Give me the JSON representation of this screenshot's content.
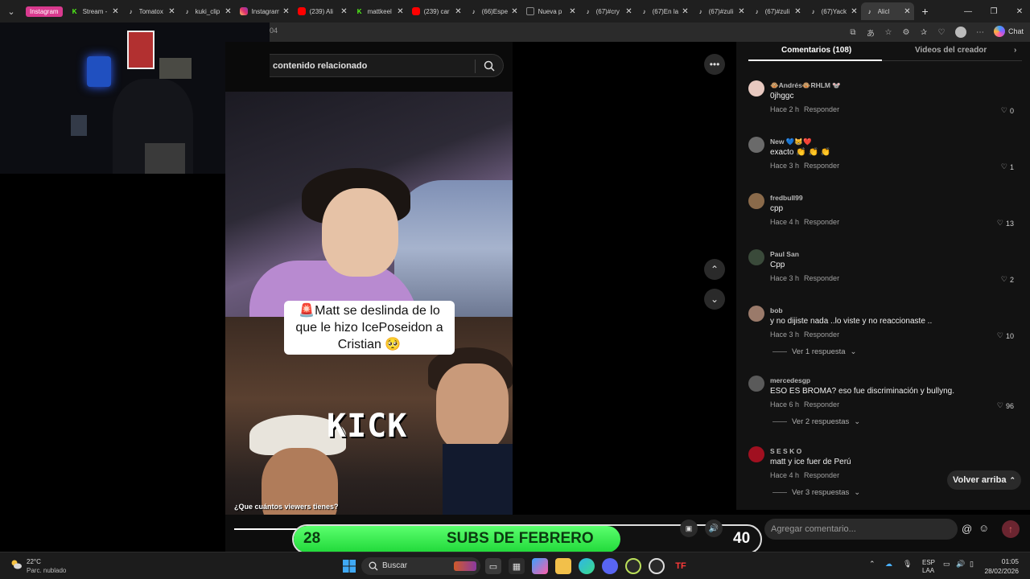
{
  "browser": {
    "tab_group_label": "Instagram",
    "tabs": [
      {
        "title": "Stream -",
        "icon": "kick-icon",
        "color": "#53fc18"
      },
      {
        "title": "Tomatox",
        "icon": "tiktok-icon",
        "color": "#ffffff"
      },
      {
        "title": "kuki_clip",
        "icon": "tiktok-icon",
        "color": "#ffffff"
      },
      {
        "title": "Instagram",
        "icon": "instagram-icon",
        "color": "#e1306c"
      },
      {
        "title": "(239) Ali",
        "icon": "youtube-icon",
        "color": "#ff0000"
      },
      {
        "title": "mattkeel",
        "icon": "kick-icon",
        "color": "#53fc18"
      },
      {
        "title": "(239) car",
        "icon": "youtube-icon",
        "color": "#ff0000"
      },
      {
        "title": "(66)Espe",
        "icon": "tiktok-icon",
        "color": "#ffffff"
      },
      {
        "title": "Nueva p",
        "icon": "newtab-icon",
        "color": "#888888"
      },
      {
        "title": "(67)#cry",
        "icon": "tiktok-icon",
        "color": "#ffffff"
      },
      {
        "title": "(67)En la",
        "icon": "tiktok-icon",
        "color": "#ffffff"
      },
      {
        "title": "(67)#zuli",
        "icon": "tiktok-icon",
        "color": "#ffffff"
      },
      {
        "title": "(67)#zuli",
        "icon": "tiktok-icon",
        "color": "#ffffff"
      },
      {
        "title": "(67)Yack",
        "icon": "tiktok-icon",
        "color": "#ffffff"
      },
      {
        "title": "Alicl",
        "icon": "tiktok-icon",
        "color": "#ffffff",
        "active": true
      }
    ],
    "url_fragment": "04",
    "chat_label": "Chat"
  },
  "video": {
    "search_text": "contenido relacionado",
    "caption_line1": "🚨Matt se deslinda de lo",
    "caption_line2": "que le hizo IcePoseidon a",
    "caption_line3": "Cristian 🥺",
    "logo_text": "KICK",
    "subtitle": "¿Que cuántos viewers tienes?"
  },
  "comments_panel": {
    "tab_comments": "Comentarios (108)",
    "tab_creator": "Videos del creador",
    "items": [
      {
        "user": "🐵Andrés🐵RHLM 🐭",
        "text": "0jhggc",
        "time": "Hace 2 h",
        "reply": "Responder",
        "likes": "0",
        "avatar_color": "#e8c9c0"
      },
      {
        "user": "New 💙😸❤️",
        "text": "exacto 👏 👏 👏",
        "time": "Hace 3 h",
        "reply": "Responder",
        "likes": "1",
        "avatar_color": "#6a6a6a"
      },
      {
        "user": "fredbull99",
        "text": "cpp",
        "time": "Hace 4 h",
        "reply": "Responder",
        "likes": "13",
        "avatar_color": "#8a6a4a"
      },
      {
        "user": "Paul San",
        "text": "Cpp",
        "time": "Hace 3 h",
        "reply": "Responder",
        "likes": "2",
        "avatar_color": "#3a4a3a"
      },
      {
        "user": "bob",
        "text": "y no dijiste nada ..lo viste y no reaccionaste ..",
        "time": "Hace 3 h",
        "reply": "Responder",
        "likes": "10",
        "avatar_color": "#9a7a6a"
      },
      {
        "user": "mercedesgp",
        "text": "ESO ES BROMA? eso fue discriminación y bullyng.",
        "time": "Hace 6 h",
        "reply": "Responder",
        "likes": "96",
        "avatar_color": "#5a5a5a"
      },
      {
        "user": "S E S K O",
        "text": "matt y ice fuer de Perú",
        "time": "Hace 4 h",
        "reply": "Responder",
        "likes": "",
        "avatar_color": "#a01020"
      }
    ],
    "replies_1": "Ver 1 respuesta",
    "replies_2": "Ver 2 respuestas",
    "replies_3": "Ver 3 respuestas",
    "back_to_top": "Volver arriba",
    "input_placeholder": "Agregar comentario..."
  },
  "overlay": {
    "subs_current": "28",
    "subs_label": "SUBS DE FEBRERO",
    "subs_goal": "40",
    "subs_progress": 0.7
  },
  "taskbar": {
    "temp": "22°C",
    "weather": "Parc. nublado",
    "search_placeholder": "Buscar",
    "lang1": "ESP",
    "lang2": "LAA",
    "time": "01:05",
    "date": "28/02/2026"
  }
}
